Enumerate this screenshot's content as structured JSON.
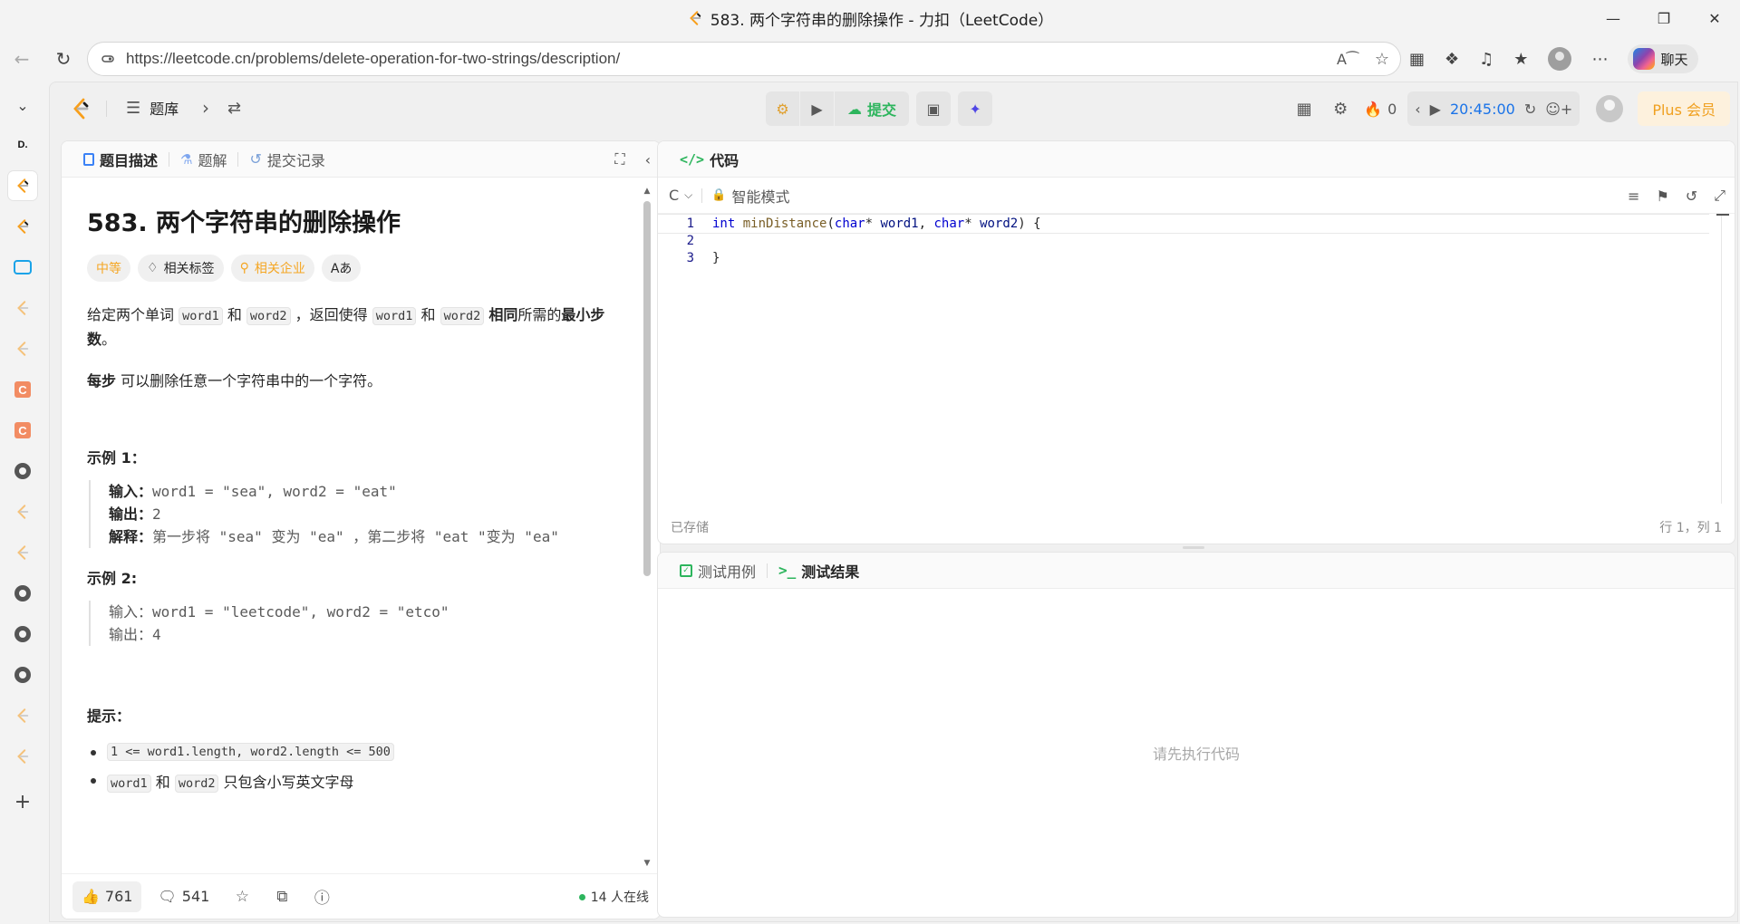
{
  "browser": {
    "window_title": "583. 两个字符串的删除操作 - 力扣（LeetCode）",
    "url": "https://leetcode.cn/problems/delete-operation-for-two-strings/description/",
    "copilot_label": "聊天"
  },
  "header": {
    "problem_list": "题库",
    "submit_label": "提交",
    "streak": "0",
    "timer": "20:45:00",
    "plus_label": "Plus 会员"
  },
  "left_tabs": [
    {
      "label": "题目描述",
      "icon": "document-icon"
    },
    {
      "label": "题解",
      "icon": "flask-icon"
    },
    {
      "label": "提交记录",
      "icon": "history-icon"
    }
  ],
  "problem": {
    "title": "583. 两个字符串的删除操作",
    "difficulty": "中等",
    "tag_topics": "相关标签",
    "tag_companies": "相关企业",
    "tag_font": "Aあ",
    "desc_p1_a": "给定两个单词 ",
    "desc_p1_code1": "word1",
    "desc_p1_b": " 和 ",
    "desc_p1_code2": "word2",
    "desc_p1_c": " ，返回使得 ",
    "desc_p1_code3": "word1",
    "desc_p1_d": " 和 ",
    "desc_p1_code4": "word2",
    "desc_p1_e": " ",
    "desc_p1_bold1": "相同",
    "desc_p1_f": "所需的",
    "desc_p1_bold2": "最小步数",
    "desc_p1_g": "。",
    "desc_p2_bold": "每步",
    "desc_p2_text": " 可以删除任意一个字符串中的一个字符。",
    "example1": {
      "heading": "示例 1：",
      "input_label": "输入：",
      "input": "word1 = \"sea\", word2 = \"eat\"",
      "output_label": "输出：",
      "output": "2",
      "explain_label": "解释：",
      "explain": "第一步将 \"sea\" 变为 \"ea\" ，第二步将 \"eat \"变为 \"ea\""
    },
    "example2": {
      "heading": "示例  2:",
      "input_line": "输入：word1 = \"leetcode\", word2 = \"etco\"",
      "output_line": "输出：4"
    },
    "hints_heading": "提示：",
    "hint1_code": "1 <= word1.length, word2.length <= 500",
    "hint2_code1": "word1",
    "hint2_mid": " 和 ",
    "hint2_code2": "word2",
    "hint2_tail": " 只包含小写英文字母"
  },
  "left_footer": {
    "likes": "761",
    "comments": "541",
    "online": "14 人在线"
  },
  "code_panel": {
    "tab_label": "代码",
    "language": "C",
    "mode": "智能模式",
    "lines": [
      {
        "no": "1"
      },
      {
        "no": "2"
      },
      {
        "no": "3",
        "text": "}"
      }
    ],
    "code_line1": {
      "kw": "int",
      "fn": "minDistance",
      "open": "(",
      "t1": "char",
      "star1": "* ",
      "p1": "word1",
      "comma": ", ",
      "t2": "char",
      "star2": "* ",
      "p2": "word2",
      "close": ") {"
    },
    "saved": "已存储",
    "cursor": "行 1，列 1"
  },
  "test_panel": {
    "tab_cases": "测试用例",
    "tab_result": "测试结果",
    "placeholder": "请先执行代码"
  }
}
